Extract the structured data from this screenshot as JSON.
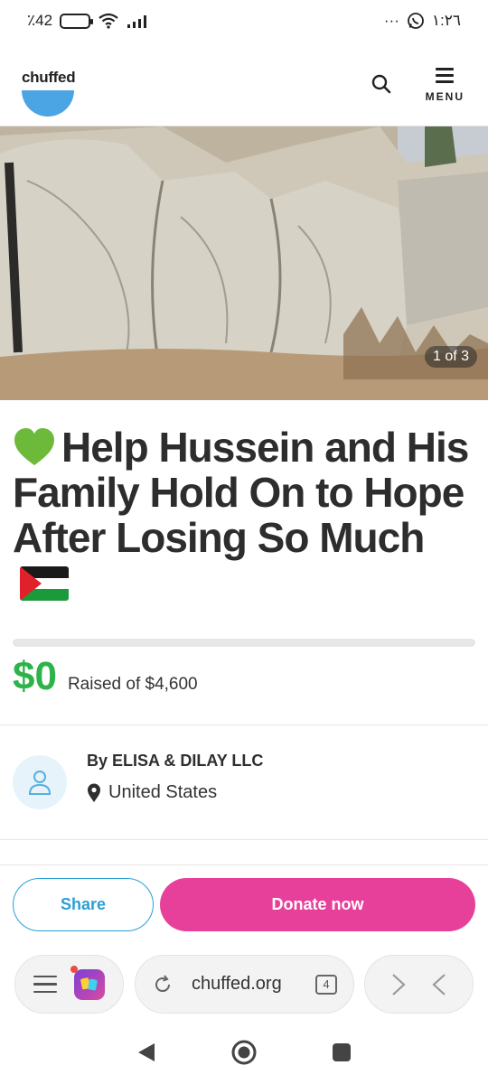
{
  "status_bar": {
    "battery_text": "٪42",
    "time": "١:٢٦",
    "more_dots": "···",
    "icons": [
      "battery-icon",
      "wifi-icon",
      "signal-icon",
      "whatsapp-icon"
    ]
  },
  "header": {
    "logo_text": "chuffed",
    "menu_label": "MENU",
    "icons": [
      "search-icon",
      "menu-icon"
    ],
    "brand_color": "#4ba5e4"
  },
  "hero": {
    "counter": "1 of 3"
  },
  "campaign": {
    "title": "Help Hussein and His Family Hold On to Hope After Losing So Much",
    "title_prefix_emoji": "green-heart-icon",
    "title_suffix_emoji": "palestine-flag-icon",
    "raised_amount": "$0",
    "raised_label": "Raised of $4,600",
    "progress_fraction": 0.0,
    "accent_color": "#2db34a"
  },
  "organiser": {
    "name": "By ELISA & DILAY LLC",
    "location": "United States"
  },
  "actions": {
    "share_label": "Share",
    "donate_label": "Donate now",
    "donate_color": "#e7409b",
    "share_color": "#2a9fd6"
  },
  "browser": {
    "url": "chuffed.org",
    "tab_count": "4"
  }
}
